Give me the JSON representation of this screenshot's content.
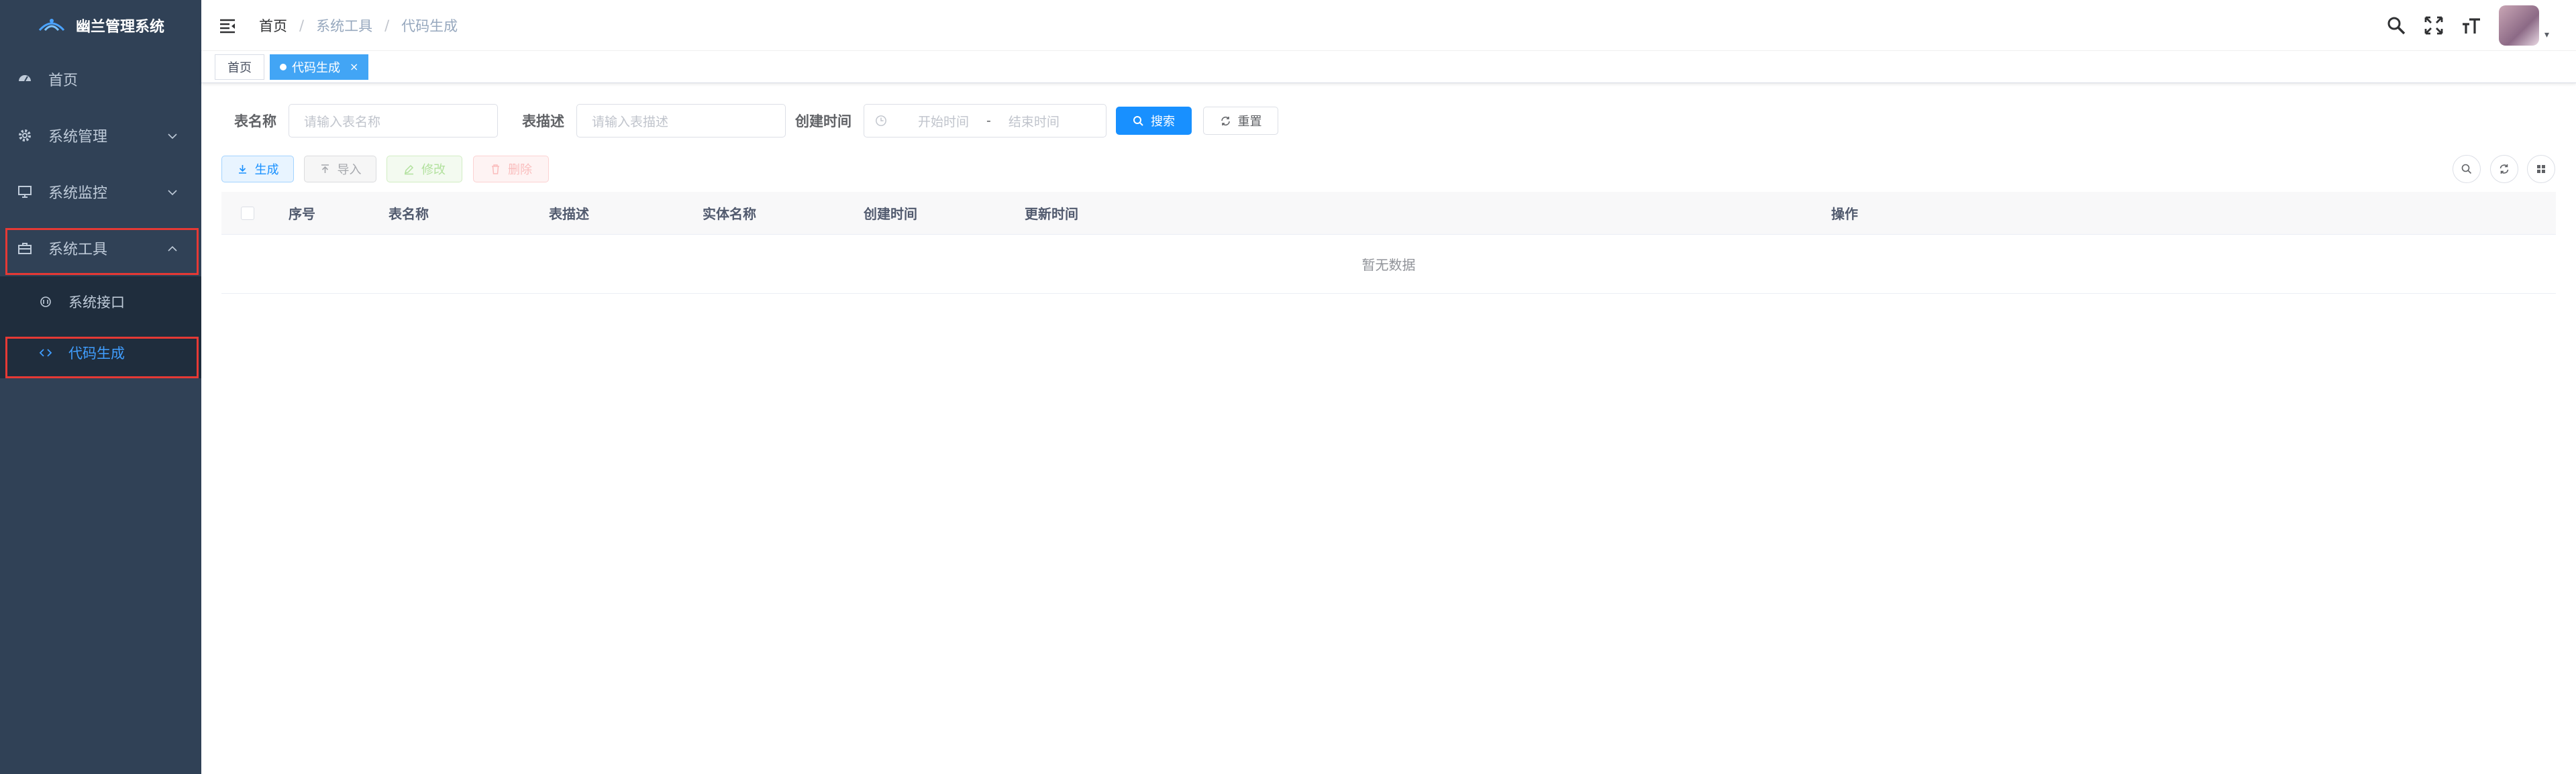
{
  "sidebar": {
    "logo_title": "幽兰管理系统",
    "menu": [
      {
        "label": "首页",
        "icon": "dashboard-icon"
      },
      {
        "label": "系统管理",
        "icon": "gear-icon"
      },
      {
        "label": "系统监控",
        "icon": "monitor-icon"
      },
      {
        "label": "系统工具",
        "icon": "toolbox-icon"
      }
    ],
    "submenu": [
      {
        "label": "系统接口",
        "icon": "api-icon"
      },
      {
        "label": "代码生成",
        "icon": "code-icon"
      }
    ]
  },
  "navbar": {
    "breadcrumb": [
      "首页",
      "系统工具",
      "代码生成"
    ],
    "separator": "/"
  },
  "tags": {
    "home": "首页",
    "active": "代码生成",
    "close": "×"
  },
  "search": {
    "table_name_label": "表名称",
    "table_name_placeholder": "请输入表名称",
    "table_desc_label": "表描述",
    "table_desc_placeholder": "请输入表描述",
    "create_time_label": "创建时间",
    "start_placeholder": "开始时间",
    "range_separator": "-",
    "end_placeholder": "结束时间",
    "search_button": "搜索",
    "reset_button": "重置"
  },
  "toolbar": {
    "generate": "生成",
    "import": "导入",
    "edit": "修改",
    "delete": "删除"
  },
  "table": {
    "columns": [
      "序号",
      "表名称",
      "表描述",
      "实体名称",
      "创建时间",
      "更新时间",
      "操作"
    ],
    "empty_text": "暂无数据"
  },
  "colors": {
    "sidebar_bg": "#304156",
    "submenu_bg": "#1f2d3d",
    "primary": "#1890ff",
    "active_tag": "#42a5f5",
    "highlight_box": "#e53935"
  }
}
